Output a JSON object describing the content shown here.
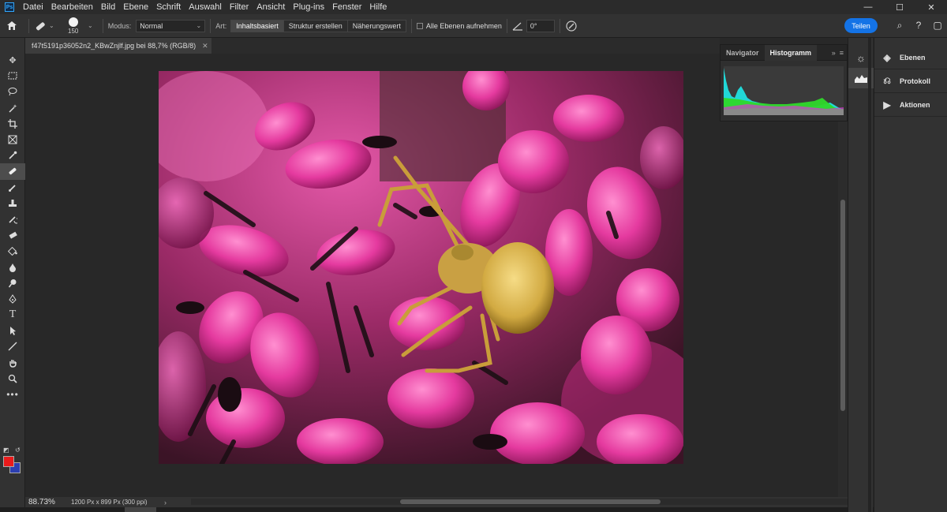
{
  "app": {
    "logo": "Ps"
  },
  "menu": [
    "Datei",
    "Bearbeiten",
    "Bild",
    "Ebene",
    "Schrift",
    "Auswahl",
    "Filter",
    "Ansicht",
    "Plug-ins",
    "Fenster",
    "Hilfe"
  ],
  "window_controls": {
    "minimize": "—",
    "maximize": "☐",
    "close": "✕"
  },
  "options": {
    "brush_size": "150",
    "mode_label": "Modus:",
    "mode_value": "Normal",
    "art_label": "Art:",
    "art_options": [
      "Inhaltsbasiert",
      "Struktur erstellen",
      "Näherungswert"
    ],
    "all_layers_label": "Alle Ebenen aufnehmen",
    "angle_value": "0°",
    "share_label": "Teilen"
  },
  "document": {
    "tab_title": "f47t5191p36052n2_KBwZnjlf.jpg bei 88,7% (RGB/8)",
    "zoom": "88.73%",
    "info": "1200 Px x 899 Px (300 ppi)"
  },
  "histogram_panel": {
    "tabs": [
      "Navigator",
      "Histogramm"
    ],
    "active_tab": "Histogramm"
  },
  "right_panels": [
    {
      "label": "Ebenen",
      "icon": "layers-icon"
    },
    {
      "label": "Protokoll",
      "icon": "history-icon"
    },
    {
      "label": "Aktionen",
      "icon": "play-icon"
    }
  ],
  "colors": {
    "foreground": "#ea1b1b",
    "background": "#2c3fb1",
    "accent": "#1473e6"
  }
}
